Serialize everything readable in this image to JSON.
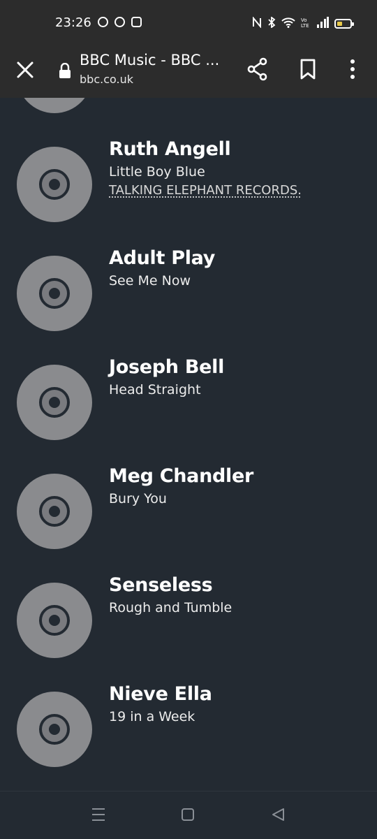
{
  "status_bar": {
    "time": "23:26",
    "app_icons": [
      "messenger-icon",
      "pinterest-icon",
      "instagram-icon"
    ],
    "system_icons": [
      "nfc-icon",
      "bluetooth-icon",
      "wifi-icon",
      "volte-icon",
      "signal-icon",
      "battery-icon"
    ],
    "battery_level": 0.3,
    "battery_color": "#e8c94a"
  },
  "toolbar": {
    "title": "BBC Music - BBC ...",
    "url": "bbc.co.uk"
  },
  "tracks": [
    {
      "artist": "Ruth Angell",
      "track": "Little Boy Blue",
      "label": "TALKING ELEPHANT RECORDS."
    },
    {
      "artist": "Adult Play",
      "track": "See Me Now"
    },
    {
      "artist": "Joseph Bell",
      "track": "Head Straight"
    },
    {
      "artist": "Meg Chandler",
      "track": "Bury You"
    },
    {
      "artist": "Senseless",
      "track": "Rough and Tumble"
    },
    {
      "artist": "Nieve Ella",
      "track": "19 in a Week"
    }
  ],
  "colors": {
    "page_background": "#232a32",
    "bar_background": "#2c2c2c",
    "disc": "#8a8b8e"
  }
}
